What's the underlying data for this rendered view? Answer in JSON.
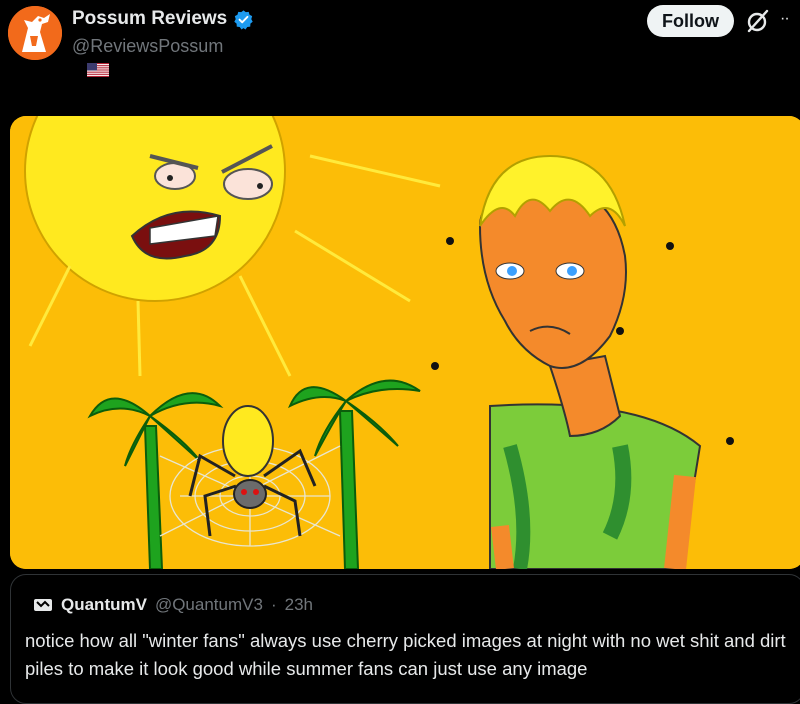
{
  "author": {
    "name": "Possum Reviews",
    "handle": "@ReviewsPossum",
    "verified": true,
    "flag": "us-flag-icon"
  },
  "actions": {
    "follow_label": "Follow",
    "grok_icon": "grok-icon",
    "more_icon": "more-icon",
    "more_glyph": "··"
  },
  "media": {
    "alt_icons": [
      "angry-sun",
      "palm-tree",
      "spider-web",
      "sweaty-man",
      "flies"
    ],
    "background": "#fcbd07"
  },
  "quote": {
    "name": "QuantumV",
    "handle": "@QuantumV3",
    "separator": "·",
    "time": "23h",
    "text": "notice how all \"winter fans\" always use cherry picked images at night with no wet shit and dirt piles to make it look good while summer fans can just use any image"
  },
  "colors": {
    "accent": "#1d9bf0",
    "avatar": "#f26a1b",
    "muted": "#71767b"
  }
}
